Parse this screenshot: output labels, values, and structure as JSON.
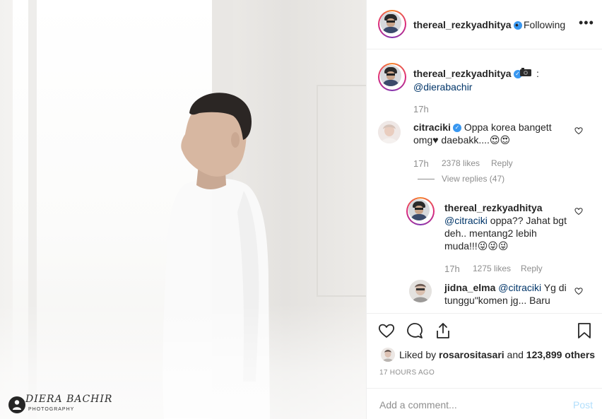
{
  "photo": {
    "watermark_title": "DIERA BACHIR",
    "watermark_subtitle": "PHOTOGRAPHY"
  },
  "header": {
    "username": "thereal_rezkyadhitya",
    "separator": "•",
    "follow_label": "Following",
    "more_icon": "more-horizontal-icon"
  },
  "caption": {
    "username": "thereal_rezkyadhitya",
    "emoji": "camera-icon",
    "colon": ":",
    "mention": "@dierabachir",
    "time": "17h"
  },
  "comments": [
    {
      "username": "citraciki",
      "text": "Oppa korea bangett omg♥ daebakk....😍😍",
      "time": "17h",
      "likes": "2378 likes",
      "reply_label": "Reply",
      "view_replies": "View replies (47)"
    },
    {
      "username": "thereal_rezkyadhitya",
      "mention": "@citraciki",
      "text": " oppa?? Jahat bgt deh.. mentang2 lebih muda!!!😜😜😜",
      "time": "17h",
      "likes": "1275 likes",
      "reply_label": "Reply"
    },
    {
      "username": "jidna_elma",
      "mention": "@citraciki",
      "text": " Yg di tunggu\"komen jg... Baru"
    }
  ],
  "actions": {
    "like_icon": "heart-icon",
    "comment_icon": "comment-icon",
    "share_icon": "share-icon",
    "save_icon": "bookmark-icon",
    "liked_by_prefix": "Liked by",
    "liked_by_user": "rosarositasari",
    "liked_by_and": "and",
    "liked_by_others": "123,899 others",
    "post_time": "17 HOURS AGO"
  },
  "add_comment": {
    "placeholder": "Add a comment...",
    "post_label": "Post"
  },
  "colors": {
    "accent_link": "#003569",
    "muted": "#8e8e8e",
    "verified": "#3897f0",
    "post_disabled": "#b2dffc"
  }
}
